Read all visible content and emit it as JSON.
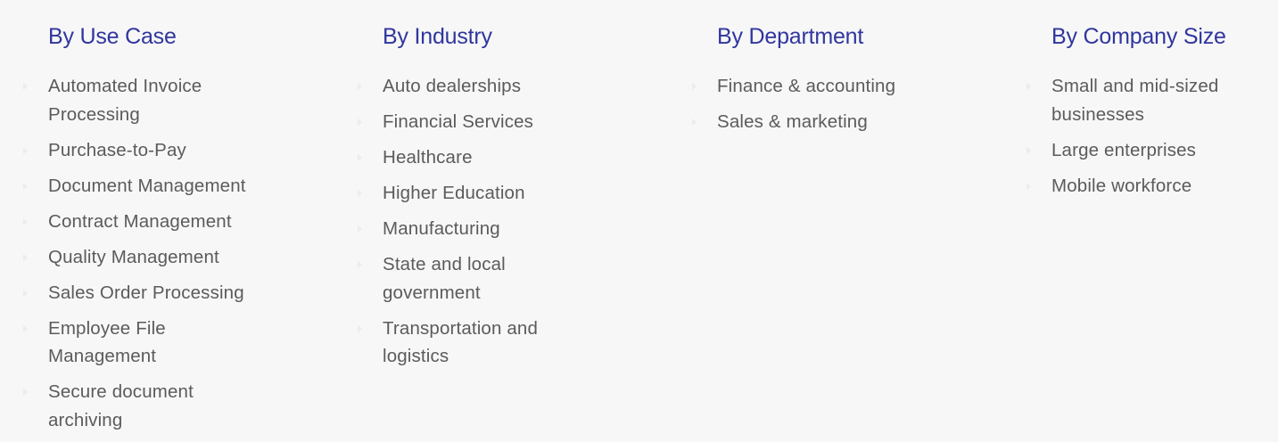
{
  "menu": {
    "columns": [
      {
        "title": "By Use Case",
        "items": [
          "Automated Invoice Processing",
          "Purchase-to-Pay",
          "Document Management",
          "Contract Management",
          "Quality Management",
          "Sales Order Processing",
          "Employee File Management",
          "Secure document archiving"
        ]
      },
      {
        "title": "By Industry",
        "items": [
          "Auto dealerships",
          "Financial Services",
          "Healthcare",
          "Higher Education",
          "Manufacturing",
          "State and local government",
          "Transportation and logistics"
        ]
      },
      {
        "title": "By Department",
        "items": [
          "Finance & accounting",
          "Sales & marketing"
        ]
      },
      {
        "title": "By Company Size",
        "items": [
          "Small and mid-sized businesses",
          "Large enterprises",
          "Mobile workforce"
        ]
      }
    ]
  },
  "colors": {
    "heading": "#30369e",
    "link": "#5b5b5b",
    "background": "#f7f7f7"
  }
}
